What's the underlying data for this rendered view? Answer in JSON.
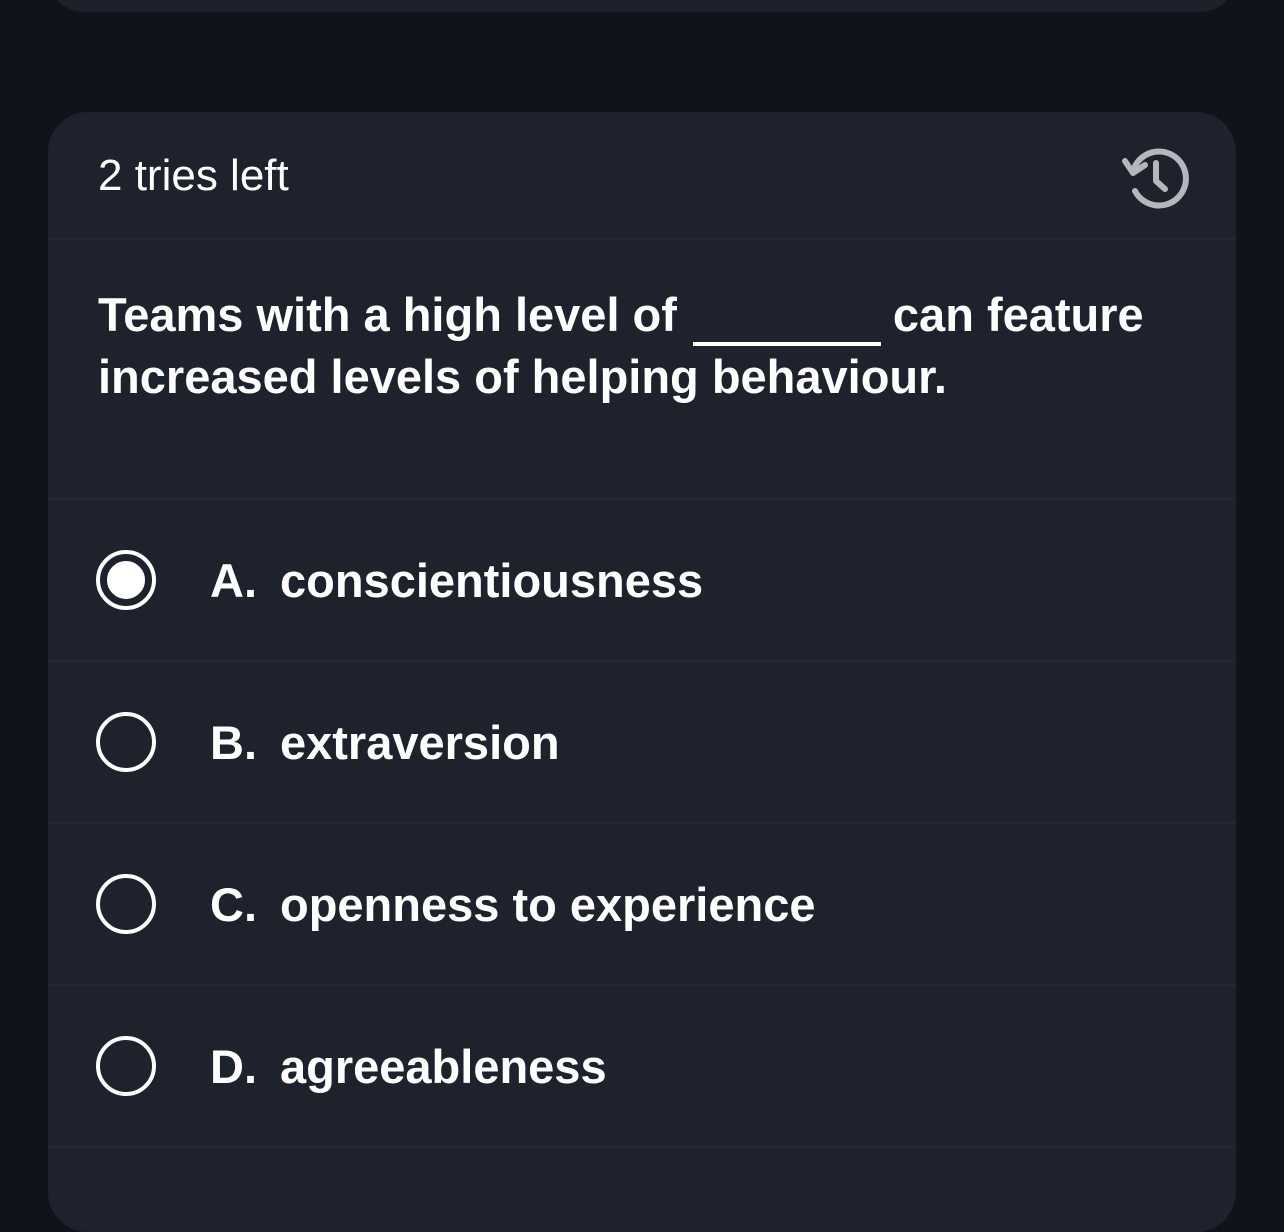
{
  "card": {
    "tries_left": "2 tries left",
    "history_icon": "history-icon"
  },
  "question": {
    "before_blank": "Teams with a high level of",
    "after_blank": "can feature increased levels of helping behaviour."
  },
  "options": [
    {
      "letter": "A.",
      "text": "conscientiousness",
      "selected": true
    },
    {
      "letter": "B.",
      "text": "extraversion",
      "selected": false
    },
    {
      "letter": "C.",
      "text": "openness to experience",
      "selected": false
    },
    {
      "letter": "D.",
      "text": "agreeableness",
      "selected": false
    }
  ],
  "colors": {
    "background": "#10131a",
    "card": "#1d222d",
    "text": "#ffffff",
    "icon": "#b4b7be"
  }
}
